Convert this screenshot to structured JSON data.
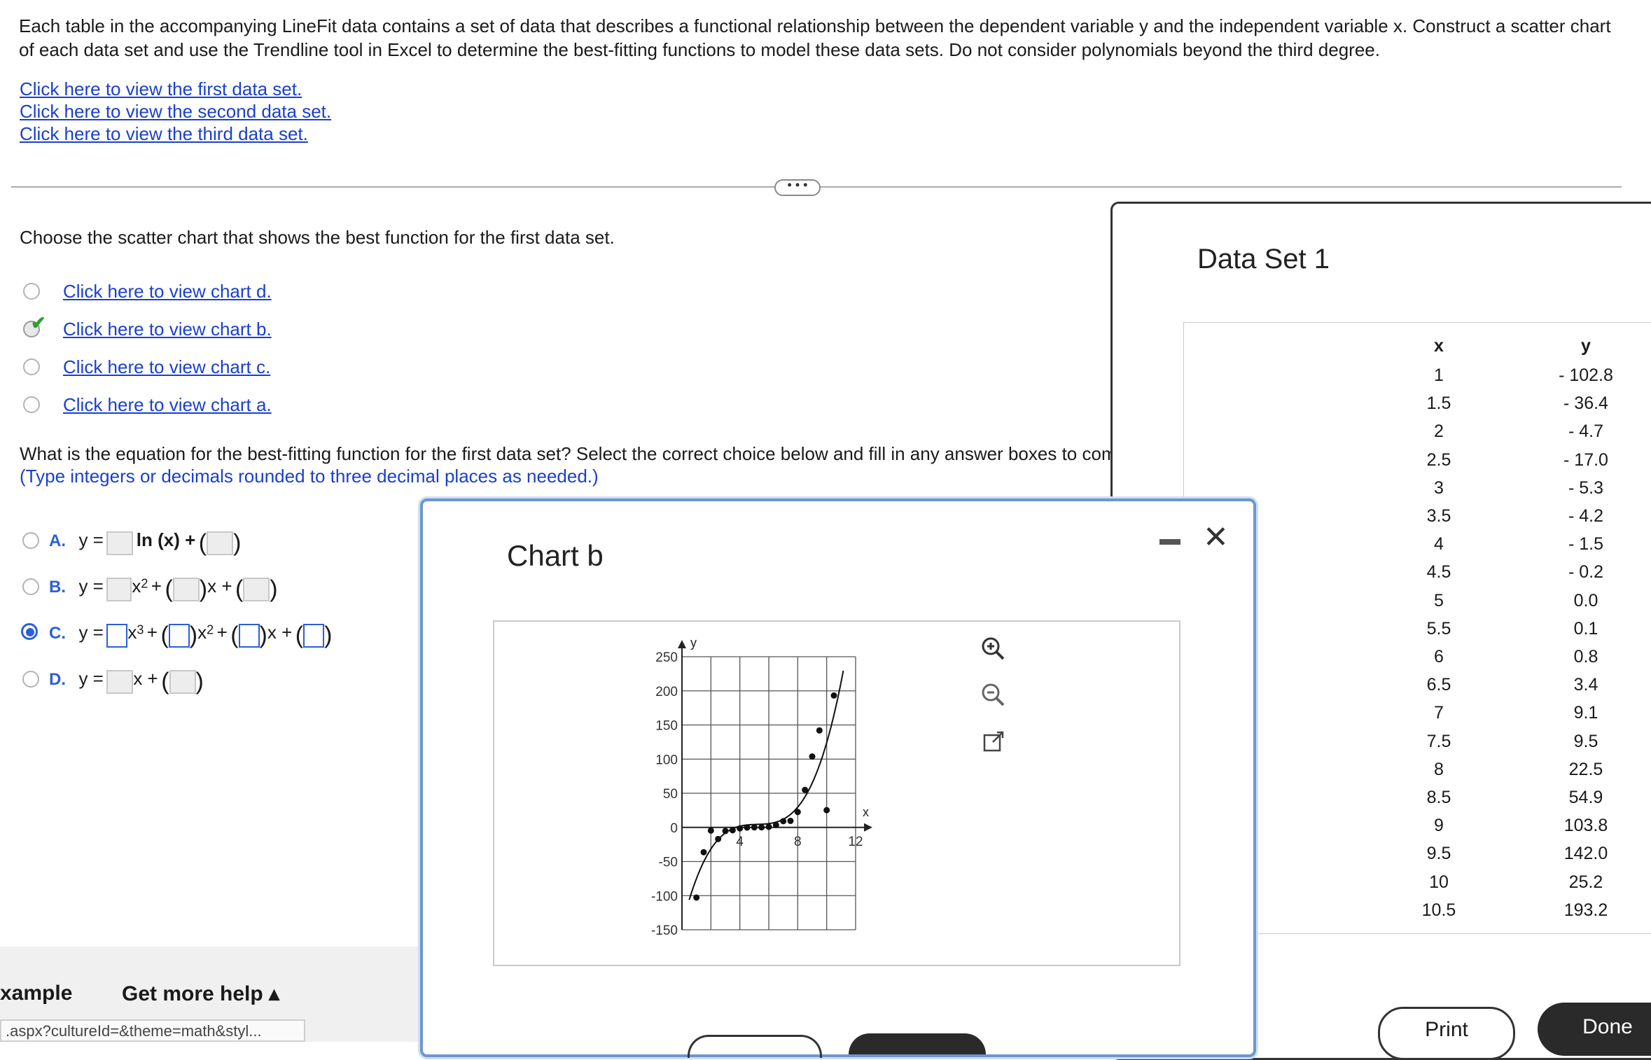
{
  "intro": {
    "line1": "Each table in the accompanying LineFit data contains a set of data that describes a functional relationship between the dependent variable y and the independent variable x. Construct a scatter chart",
    "line2": "of each data set and use the Trendline tool in Excel to determine the best-fitting functions to model these data sets. Do not consider polynomials beyond the third degree."
  },
  "data_links": [
    "Click here to view the first data set.",
    "Click here to view the second data set.",
    "Click here to view the third data set."
  ],
  "more_button": "• • •",
  "question1": "Choose the scatter chart that shows the best function for the first data set.",
  "chart_choices": [
    "Click here to view chart d.",
    "Click here to view chart b.",
    "Click here to view chart c.",
    "Click here to view chart a."
  ],
  "question2": {
    "line1": "What is the equation for the best-fitting function for the first data set? Select the correct choice below and fill in any answer boxes to com",
    "line2": "(Type integers or decimals rounded to three decimal places as needed.)"
  },
  "options": [
    {
      "letter": "A.",
      "lhs": "y =",
      "parts": [
        "ln (x) +"
      ]
    },
    {
      "letter": "B.",
      "lhs": "y =",
      "parts": [
        "x",
        "2",
        "+",
        "x +"
      ]
    },
    {
      "letter": "C.",
      "lhs": "y =",
      "parts": [
        "x",
        "3",
        "+",
        "x",
        "2",
        "+",
        "x +"
      ]
    },
    {
      "letter": "D.",
      "lhs": "y =",
      "parts": [
        "x +"
      ]
    }
  ],
  "bottom": {
    "example": "xample",
    "help": "Get more help ▴",
    "url": ".aspx?cultureId=&theme=math&styl..."
  },
  "dataset": {
    "title": "Data Set 1",
    "x_header": "x",
    "y_header": "y",
    "x": [
      "1",
      "1.5",
      "2",
      "2.5",
      "3",
      "3.5",
      "4",
      "4.5",
      "5",
      "5.5",
      "6",
      "6.5",
      "7",
      "7.5",
      "8",
      "8.5",
      "9",
      "9.5",
      "10",
      "10.5"
    ],
    "y": [
      "- 102.8",
      "- 36.4",
      "- 4.7",
      "- 17.0",
      "- 5.3",
      "- 4.2",
      "- 1.5",
      "- 0.2",
      "0.0",
      "0.1",
      "0.8",
      "3.4",
      "9.1",
      "9.5",
      "22.5",
      "54.9",
      "103.8",
      "142.0",
      "25.2",
      "193.2"
    ],
    "print_label": "Print",
    "done_label": "Done"
  },
  "chart_panel": {
    "title": "Chart b",
    "minimize_icon": "minimize-icon",
    "close_icon": "close-icon"
  },
  "chart_data": {
    "type": "scatter",
    "title": "",
    "xlabel": "x",
    "ylabel": "y",
    "xlim": [
      0,
      12
    ],
    "ylim": [
      -150,
      250
    ],
    "x_ticks": [
      "4",
      "8",
      "12"
    ],
    "y_ticks": [
      "250",
      "200",
      "150",
      "100",
      "50",
      "0",
      "-50",
      "-100",
      "-150"
    ],
    "grid": true,
    "points": {
      "x": [
        1,
        1.5,
        2,
        2.5,
        3,
        3.5,
        4,
        4.5,
        5,
        5.5,
        6,
        6.5,
        7,
        7.5,
        8,
        8.5,
        9,
        9.5,
        10,
        10.5
      ],
      "y": [
        -102.8,
        -36.4,
        -4.7,
        -17.0,
        -5.3,
        -4.2,
        -1.5,
        -0.2,
        0.0,
        0.1,
        0.8,
        3.4,
        9.1,
        9.5,
        22.5,
        54.9,
        103.8,
        142.0,
        25.2,
        193.2
      ]
    },
    "trendline": {
      "type": "cubic"
    }
  }
}
